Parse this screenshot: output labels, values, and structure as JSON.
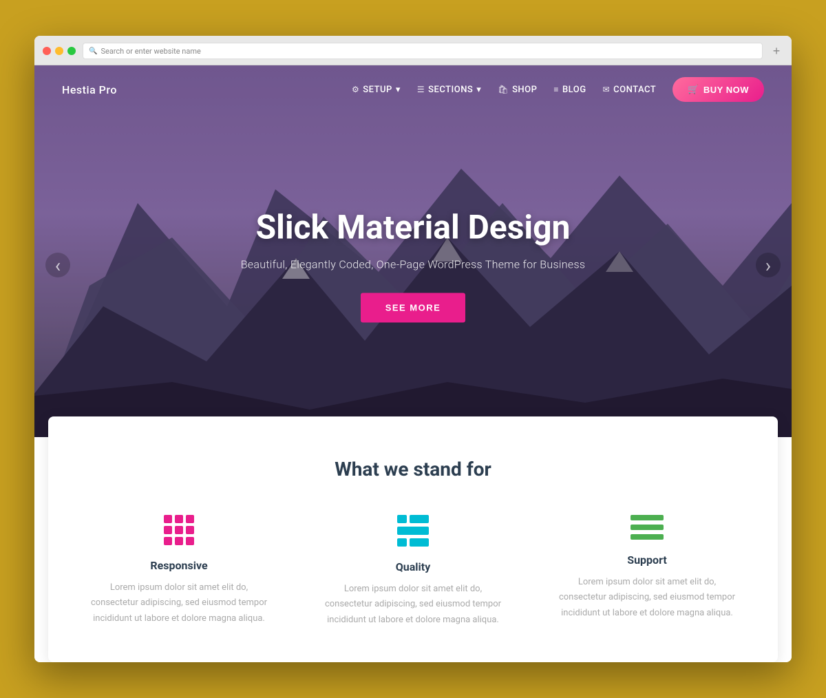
{
  "browser": {
    "address_placeholder": "Search or enter website name"
  },
  "navbar": {
    "brand": "Hestia Pro",
    "setup_label": "SETUP",
    "sections_label": "SECTIONS",
    "shop_label": "SHOP",
    "blog_label": "BLOG",
    "contact_label": "CONTACT",
    "buy_now_label": "BUY NOW"
  },
  "hero": {
    "title": "Slick Material Design",
    "subtitle": "Beautiful, Elegantly Coded, One-Page WordPress Theme for Business",
    "cta_label": "SEE MORE"
  },
  "features": {
    "section_title": "What we stand for",
    "items": [
      {
        "title": "Responsive",
        "description": "Lorem ipsum dolor sit amet elit do, consectetur adipiscing, sed eiusmod tempor incididunt ut labore et dolore magna aliqua."
      },
      {
        "title": "Quality",
        "description": "Lorem ipsum dolor sit amet elit do, consectetur adipiscing, sed eiusmod tempor incididunt ut labore et dolore magna aliqua."
      },
      {
        "title": "Support",
        "description": "Lorem ipsum dolor sit amet elit do, consectetur adipiscing, sed eiusmod tempor incididunt ut labore et dolore magna aliqua."
      }
    ]
  }
}
